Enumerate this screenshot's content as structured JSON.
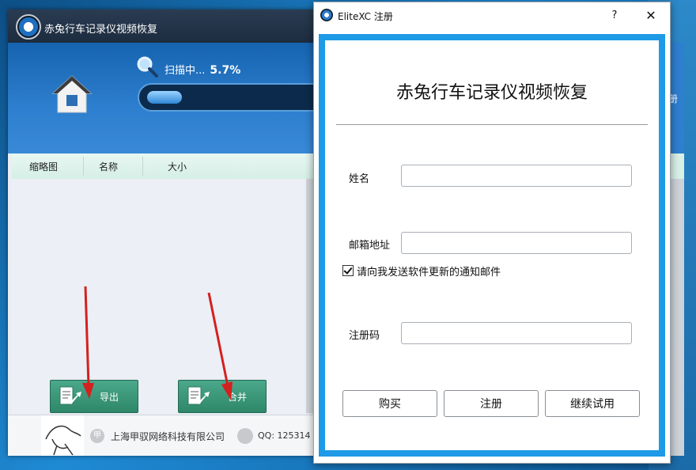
{
  "app": {
    "title": "赤兔行车记录仪视频恢复",
    "scan_label": "扫描中...",
    "scan_percent": "5.7%",
    "progress": 0.057,
    "columns": [
      "缩略图",
      "名称",
      "大小"
    ],
    "export_label": "导出",
    "merge_label": "合并",
    "company": "上海甲驭网络科技有限公司",
    "qq": "QQ: 125314",
    "peek_char": "册"
  },
  "dialog": {
    "title": "EliteXC 注册",
    "help": "?",
    "close": "✕",
    "heading": "赤兔行车记录仪视频恢复",
    "name_label": "姓名",
    "name_value": "",
    "email_label": "邮箱地址",
    "email_value": "",
    "checkbox_label": "请向我发送软件更新的通知邮件",
    "checkbox_checked": true,
    "code_label": "注册码",
    "code_value": "",
    "buy_label": "购买",
    "register_label": "注册",
    "trial_label": "继续试用"
  },
  "colors": {
    "header_blue": "#2e7fcf",
    "dialog_frame": "#1e9ae6",
    "green_button": "#3a9a7a",
    "arrow_red": "#d42020"
  }
}
